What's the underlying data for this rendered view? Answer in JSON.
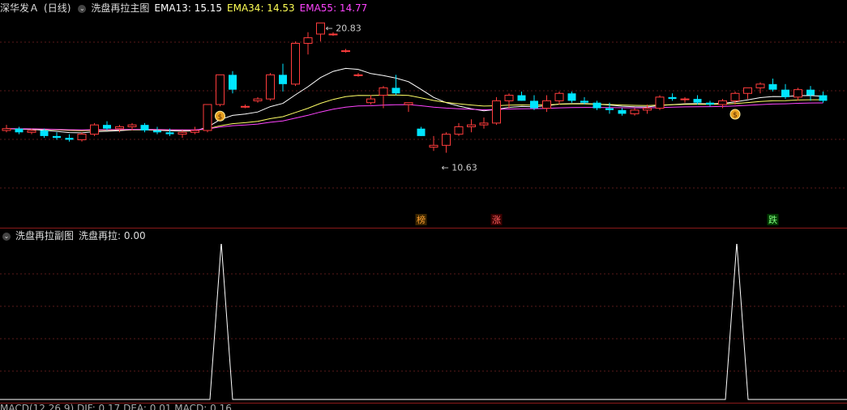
{
  "main_header": {
    "stock_name": "深华发Ａ",
    "period": "(日线)",
    "indicator_name": "洗盘再拉主图",
    "ema13_label": "EMA13: 15.15",
    "ema34_label": "EMA34: 14.53",
    "ema55_label": "EMA55: 14.77"
  },
  "main_chart": {
    "high_label": "20.83",
    "low_label": "10.63",
    "markers": {
      "bang": "榜",
      "zhang": "涨",
      "die": "跌"
    },
    "colors": {
      "up": "#ff3c3c",
      "down": "#00e5ff",
      "ema13": "#ffffff",
      "ema34": "#ffff66",
      "ema55": "#ff44ff"
    }
  },
  "sub_header": {
    "indicator_name": "洗盘再拉副图",
    "value_label": "洗盘再拉: 0.00"
  },
  "bottom_header": {
    "text": "MACD(12,26,9)  DIF: 0.17  DEA: 0.01  MACD: 0.16"
  },
  "chart_data": {
    "type": "candlestick",
    "ohlc": [
      [
        15.0,
        15.3,
        14.9,
        15.1
      ],
      [
        15.1,
        15.2,
        14.8,
        14.9
      ],
      [
        14.9,
        15.1,
        14.8,
        15.0
      ],
      [
        15.0,
        15.1,
        14.6,
        14.7
      ],
      [
        14.7,
        14.9,
        14.5,
        14.6
      ],
      [
        14.6,
        14.8,
        14.4,
        14.5
      ],
      [
        14.5,
        14.9,
        14.4,
        14.8
      ],
      [
        14.8,
        15.4,
        14.7,
        15.3
      ],
      [
        15.3,
        15.5,
        15.0,
        15.1
      ],
      [
        15.1,
        15.3,
        14.9,
        15.2
      ],
      [
        15.2,
        15.4,
        15.0,
        15.3
      ],
      [
        15.3,
        15.4,
        14.9,
        15.0
      ],
      [
        15.0,
        15.2,
        14.8,
        14.9
      ],
      [
        14.9,
        15.1,
        14.7,
        14.8
      ],
      [
        14.8,
        15.0,
        14.6,
        14.9
      ],
      [
        14.9,
        15.2,
        14.8,
        15.0
      ],
      [
        15.0,
        16.4,
        14.9,
        16.4
      ],
      [
        16.4,
        18.0,
        16.3,
        18.0
      ],
      [
        18.0,
        18.2,
        17.0,
        17.2
      ],
      [
        16.3,
        16.4,
        16.2,
        16.3
      ],
      [
        16.6,
        16.8,
        16.5,
        16.7
      ],
      [
        16.7,
        18.1,
        16.6,
        18.0
      ],
      [
        18.0,
        18.6,
        17.1,
        17.5
      ],
      [
        17.5,
        19.8,
        17.4,
        19.7
      ],
      [
        19.7,
        20.3,
        19.1,
        20.0
      ],
      [
        20.2,
        20.8,
        19.8,
        20.8
      ],
      [
        20.2,
        20.3,
        20.1,
        20.2
      ],
      [
        19.3,
        19.4,
        19.2,
        19.3
      ],
      [
        18.0,
        18.1,
        17.9,
        18.0
      ],
      [
        16.5,
        16.9,
        16.4,
        16.7
      ],
      [
        16.9,
        17.4,
        16.2,
        17.3
      ],
      [
        17.3,
        18.0,
        16.9,
        17.0
      ],
      [
        16.4,
        16.5,
        16.0,
        16.5
      ],
      [
        15.1,
        15.2,
        14.7,
        14.7
      ],
      [
        14.1,
        14.7,
        13.9,
        14.2
      ],
      [
        14.2,
        14.9,
        13.8,
        14.8
      ],
      [
        14.8,
        15.4,
        14.7,
        15.2
      ],
      [
        15.2,
        15.6,
        14.9,
        15.3
      ],
      [
        15.3,
        15.7,
        15.1,
        15.4
      ],
      [
        15.4,
        16.8,
        15.3,
        16.6
      ],
      [
        16.6,
        17.0,
        16.2,
        16.9
      ],
      [
        16.9,
        17.1,
        16.6,
        16.6
      ],
      [
        16.6,
        16.9,
        16.1,
        16.2
      ],
      [
        16.2,
        16.9,
        16.0,
        16.6
      ],
      [
        16.6,
        17.1,
        16.4,
        17.0
      ],
      [
        17.0,
        17.1,
        16.5,
        16.6
      ],
      [
        16.6,
        16.8,
        16.4,
        16.5
      ],
      [
        16.5,
        16.6,
        16.1,
        16.2
      ],
      [
        16.2,
        16.5,
        15.9,
        16.1
      ],
      [
        16.1,
        16.2,
        15.8,
        15.9
      ],
      [
        15.9,
        16.2,
        15.8,
        16.1
      ],
      [
        16.1,
        16.4,
        15.9,
        16.2
      ],
      [
        16.2,
        16.9,
        16.1,
        16.8
      ],
      [
        16.8,
        17.0,
        16.6,
        16.7
      ],
      [
        16.7,
        16.8,
        16.5,
        16.7
      ],
      [
        16.7,
        16.9,
        16.4,
        16.5
      ],
      [
        16.5,
        16.6,
        16.3,
        16.4
      ],
      [
        16.4,
        16.7,
        16.2,
        16.6
      ],
      [
        16.6,
        17.1,
        16.4,
        17.0
      ],
      [
        17.0,
        17.3,
        16.7,
        17.3
      ],
      [
        17.3,
        17.6,
        17.0,
        17.5
      ],
      [
        17.5,
        17.8,
        17.1,
        17.2
      ],
      [
        17.2,
        17.5,
        16.7,
        16.8
      ],
      [
        16.8,
        17.3,
        16.6,
        17.2
      ],
      [
        17.2,
        17.4,
        16.6,
        16.9
      ],
      [
        16.9,
        17.1,
        16.5,
        16.6
      ]
    ],
    "up_color": "#ff3c3c",
    "down_color": "#00e5ff",
    "sub_spikes": [
      273,
      909
    ]
  }
}
